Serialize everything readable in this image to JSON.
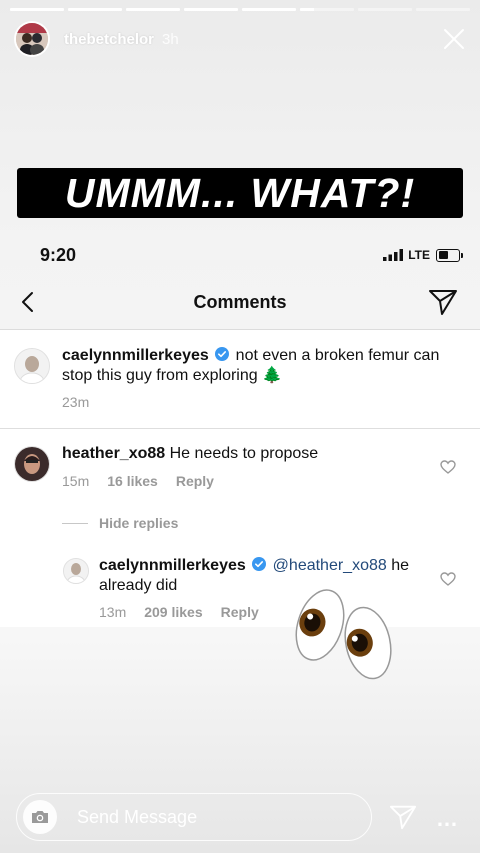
{
  "story": {
    "progress": [
      1,
      1,
      1,
      1,
      1,
      0.25,
      0,
      0
    ],
    "username": "thebetchelor",
    "time": "3h",
    "headline": "UMMM... WHAT?!"
  },
  "screenshot": {
    "status_bar": {
      "time": "9:20",
      "network": "LTE",
      "battery_level": 0.5
    },
    "nav": {
      "title": "Comments"
    },
    "caption": {
      "username": "caelynnmillerkeyes",
      "verified": true,
      "text": "not even a broken femur can",
      "text_line2": "stop this guy from exploring",
      "emoji": "🌲",
      "time": "23m"
    },
    "comments": [
      {
        "username": "heather_xo88",
        "text": "He needs to propose",
        "time": "15m",
        "likes": "16 likes",
        "reply_label": "Reply",
        "hide_replies_label": "Hide replies",
        "replies": [
          {
            "username": "caelynnmillerkeyes",
            "verified": true,
            "mention": "@heather_xo88",
            "text": "he",
            "text_line2": "already did",
            "time": "13m",
            "likes": "209 likes",
            "reply_label": "Reply"
          }
        ]
      }
    ]
  },
  "sticker": {
    "icon": "eyes-emoji"
  },
  "bottom_bar": {
    "placeholder": "Send Message",
    "more": "…"
  },
  "colors": {
    "verified": "#3897f0",
    "headline_bg": "#000000",
    "mention": "#234a7a"
  }
}
